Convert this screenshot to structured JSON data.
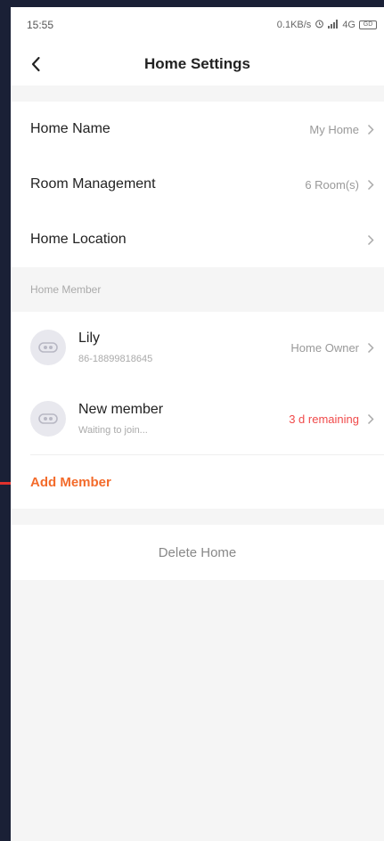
{
  "status_bar": {
    "time": "15:55",
    "network_speed": "0.1KB/s",
    "alarm_icon": "alarm-icon",
    "signal": "4G",
    "battery": "GD"
  },
  "nav": {
    "title": "Home Settings",
    "back_icon": "chevron-left-icon"
  },
  "settings": [
    {
      "label": "Home Name",
      "value": "My Home"
    },
    {
      "label": "Room Management",
      "value": "6 Room(s)"
    },
    {
      "label": "Home Location",
      "value": ""
    }
  ],
  "members_section": {
    "header": "Home Member",
    "members": [
      {
        "name": "Lily",
        "sub": "86-18899818645",
        "status": "Home Owner",
        "status_color": "#999999"
      },
      {
        "name": "New member",
        "sub": "Waiting to join...",
        "status": "3 d remaining",
        "status_color": "#f04a4a"
      }
    ],
    "add_label": "Add Member"
  },
  "delete_label": "Delete Home",
  "colors": {
    "accent": "#f36b2b",
    "warning": "#f04a4a",
    "background": "#f5f5f5",
    "frame": "#1a2036"
  }
}
